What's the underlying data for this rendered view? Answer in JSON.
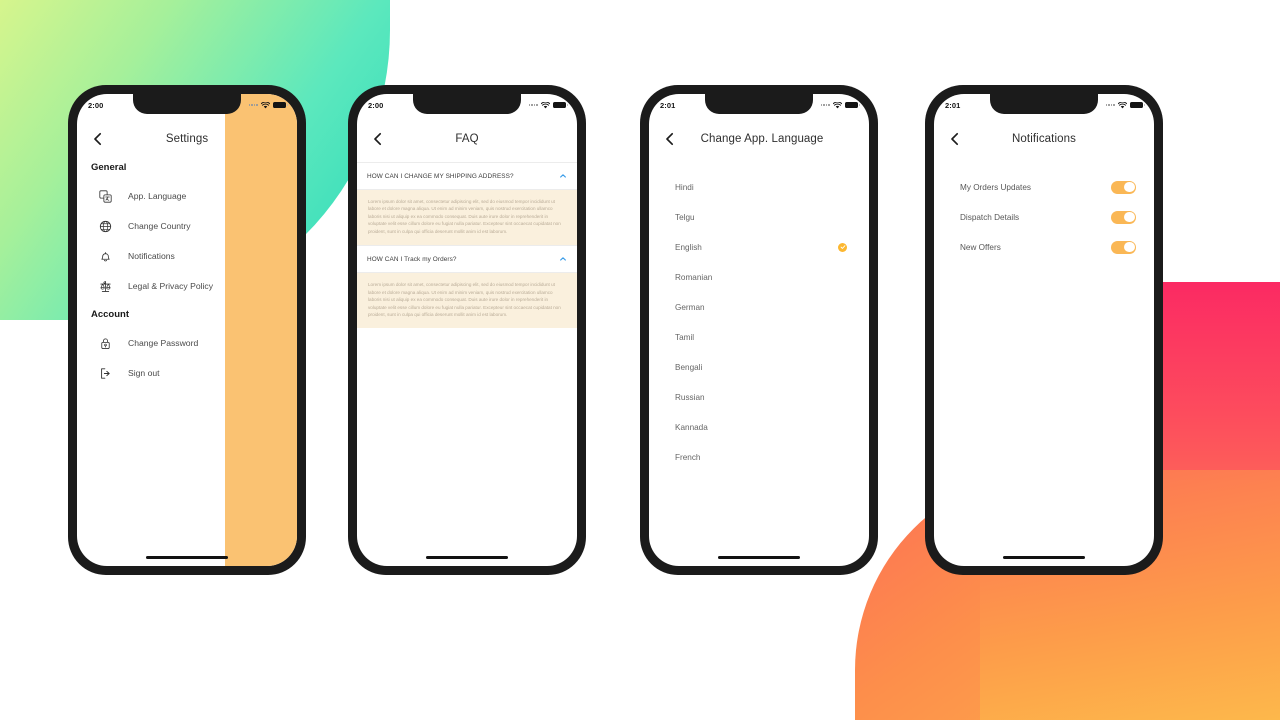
{
  "background": {
    "green_blob_colors": [
      "#d6f58d",
      "#25d8bb"
    ],
    "pink_blob_colors": [
      "#fb2a63",
      "#fd6d56"
    ],
    "orange_blob_colors": [
      "#fd6f56",
      "#fdb14a"
    ],
    "page_background": "#ffffff"
  },
  "theme": {
    "accent_orange": "#fab755",
    "panel_orange": "#fac272",
    "check_badge": "#fcb730",
    "chevron_blue": "#3a9ce8",
    "faq_answer_bg": "#faf0dd"
  },
  "phones": [
    {
      "id": "settings",
      "status_bar": {
        "time": "2:00",
        "signal_icon": "signal-dots-icon",
        "wifi_icon": "wifi-icon",
        "battery_icon": "battery-icon"
      },
      "nav": {
        "back_icon": "back-chevron-icon",
        "title": "Settings"
      },
      "sections": [
        {
          "heading": "General",
          "items": [
            {
              "icon": "translate-icon",
              "label": "App. Language"
            },
            {
              "icon": "globe-icon",
              "label": "Change Country"
            },
            {
              "icon": "bell-icon",
              "label": "Notifications"
            },
            {
              "icon": "scales-icon",
              "label": "Legal & Privacy Policy"
            }
          ]
        },
        {
          "heading": "Account",
          "items": [
            {
              "icon": "lock-icon",
              "label": "Change Password"
            },
            {
              "icon": "logout-icon",
              "label": "Sign out"
            }
          ]
        }
      ]
    },
    {
      "id": "faq",
      "status_bar": {
        "time": "2:00"
      },
      "nav": {
        "title": "FAQ"
      },
      "items": [
        {
          "question": "HOW CAN I CHANGE MY SHIPPING ADDRESS?",
          "expanded": true,
          "chevron": "chevron-up-icon",
          "answer": "Lorem ipsum dolor sit amet, consectetur adipiscing elit, sed do eiusmod tempor incididunt ut labore et dolore magna aliqua. Ut enim ad minim veniam, quis nostrud exercitation ullamco laboris nisi ut aliquip ex ea commodo consequat. Duis aute irure dolor in reprehenderit in voluptate velit esse cillum dolore eu fugiat nulla pariatur. Excepteur sint occaecat cupidatat non proident, sunt in culpa qui officia deserunt mollit anim id est laborum."
        },
        {
          "question": "HOW CAN I Track my Orders?",
          "expanded": true,
          "chevron": "chevron-up-icon",
          "answer": "Lorem ipsum dolor sit amet, consectetur adipiscing elit, sed do eiusmod tempor incididunt ut labore et dolore magna aliqua. Ut enim ad minim veniam, quis nostrud exercitation ullamco laboris nisi ut aliquip ex ea commodo consequat. Duis aute irure dolor in reprehenderit in voluptate velit esse cillum dolore eu fugiat nulla pariatur. Excepteur sint occaecat cupidatat non proident, sunt in culpa qui officia deserunt mollit anim id est laborum."
        }
      ]
    },
    {
      "id": "language",
      "status_bar": {
        "time": "2:01"
      },
      "nav": {
        "title": "Change App. Language"
      },
      "languages": [
        {
          "name": "Hindi",
          "selected": false
        },
        {
          "name": "Telgu",
          "selected": false
        },
        {
          "name": "English",
          "selected": true
        },
        {
          "name": "Romanian",
          "selected": false
        },
        {
          "name": "German",
          "selected": false
        },
        {
          "name": "Tamil",
          "selected": false
        },
        {
          "name": "Bengali",
          "selected": false
        },
        {
          "name": "Russian",
          "selected": false
        },
        {
          "name": "Kannada",
          "selected": false
        },
        {
          "name": "French",
          "selected": false
        }
      ]
    },
    {
      "id": "notifications",
      "status_bar": {
        "time": "2:01"
      },
      "nav": {
        "title": "Notifications"
      },
      "toggles": [
        {
          "label": "My Orders Updates",
          "on": true
        },
        {
          "label": "Dispatch Details",
          "on": true
        },
        {
          "label": "New Offers",
          "on": true
        }
      ]
    }
  ]
}
